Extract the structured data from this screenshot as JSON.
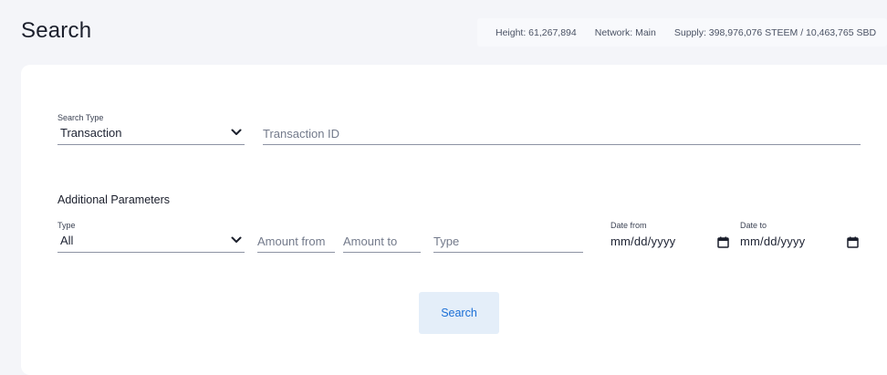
{
  "page": {
    "title": "Search"
  },
  "stats": {
    "height": "Height: 61,267,894",
    "network": "Network: Main",
    "supply": "Supply: 398,976,076 STEEM / 10,463,765 SBD"
  },
  "search_type": {
    "label": "Search Type",
    "value": "Transaction"
  },
  "transaction_id": {
    "placeholder": "Transaction ID"
  },
  "additional": {
    "heading": "Additional Parameters",
    "type_select": {
      "label": "Type",
      "value": "All"
    },
    "amount_from": {
      "placeholder": "Amount from"
    },
    "amount_to": {
      "placeholder": "Amount to"
    },
    "type_input": {
      "placeholder": "Type"
    },
    "date_from": {
      "label": "Date from",
      "value": "mm/dd/yyyy"
    },
    "date_to": {
      "label": "Date to",
      "value": "mm/dd/yyyy"
    }
  },
  "search_button": {
    "label": "Search"
  },
  "icons": {
    "chevron": "chevron-down-icon",
    "calendar": "calendar-icon"
  },
  "colors": {
    "accent": "#1b6fd6",
    "button_bg": "#e4eef9",
    "page_bg": "#f4f5f9",
    "card_bg": "#ffffff"
  }
}
